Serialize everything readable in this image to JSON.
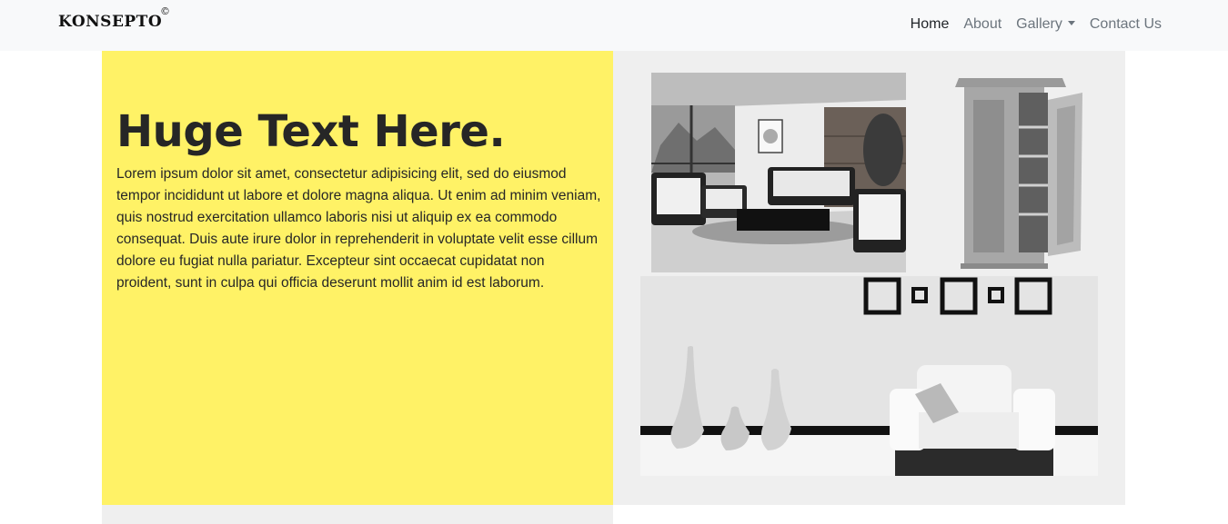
{
  "brand": {
    "name": "KONSEPTO",
    "mark": "©"
  },
  "nav": {
    "items": [
      {
        "label": "Home",
        "active": true
      },
      {
        "label": "About",
        "active": false
      },
      {
        "label": "Gallery",
        "active": false,
        "dropdown": true
      },
      {
        "label": "Contact Us",
        "active": false
      }
    ]
  },
  "hero": {
    "headline": "Huge Text Here.",
    "body": "Lorem ipsum dolor sit amet, consectetur adipisicing elit, sed do eiusmod tempor incididunt ut labore et dolore magna aliqua. Ut enim ad minim veniam, quis nostrud exercitation ullamco laboris nisi ut aliquip ex ea commodo consequat. Duis aute irure dolor in reprehenderit in voluptate velit esse cillum dolore eu fugiat nulla pariatur. Excepteur sint occaecat cupidatat non proident, sunt in culpa qui officia deserunt mollit anim id est laborum."
  },
  "colors": {
    "accent_yellow": "#fff266",
    "panel_gray": "#efefef",
    "navbar_bg": "#f8f9fa",
    "text_dark": "#262626"
  },
  "gallery": {
    "images": [
      {
        "name": "living-room-photo"
      },
      {
        "name": "wardrobe-photo"
      },
      {
        "name": "white-armchair-vases-photo"
      }
    ]
  }
}
